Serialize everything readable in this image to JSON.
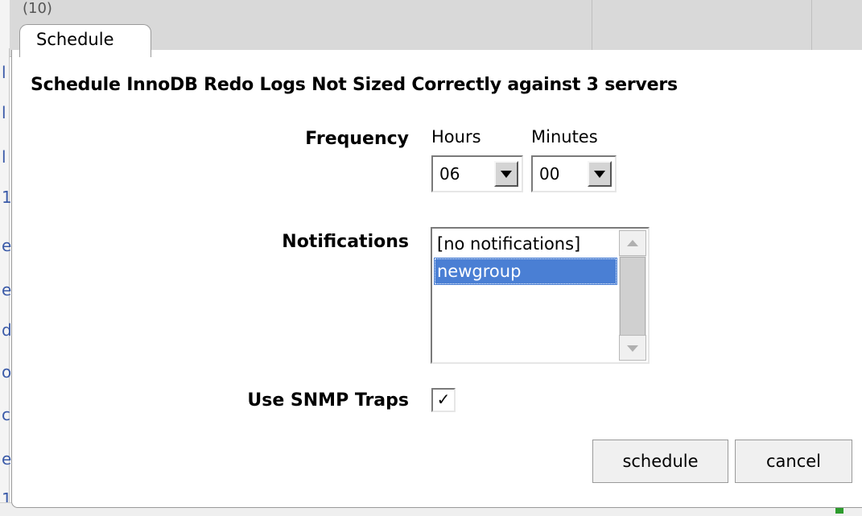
{
  "background": {
    "top_fragment": "(10)",
    "left_fragments": [
      "l",
      "l",
      "l",
      "1",
      "e",
      "e",
      "d",
      "o",
      "c",
      "e",
      "1"
    ]
  },
  "dialog": {
    "tab_label": "Schedule",
    "title": "Schedule InnoDB Redo Logs Not Sized Correctly against 3 servers",
    "frequency": {
      "label": "Frequency",
      "hours_label": "Hours",
      "minutes_label": "Minutes",
      "hours_value": "06",
      "minutes_value": "00"
    },
    "notifications": {
      "label": "Notifications",
      "options": [
        "[no notifications]",
        "newgroup"
      ],
      "selected": "newgroup"
    },
    "snmp": {
      "label": "Use SNMP Traps",
      "checked": true,
      "check_glyph": "✓"
    },
    "buttons": {
      "schedule": "schedule",
      "cancel": "cancel"
    }
  },
  "colors": {
    "selection": "#4a7fd4",
    "button_bg": "#f0f0f0"
  }
}
